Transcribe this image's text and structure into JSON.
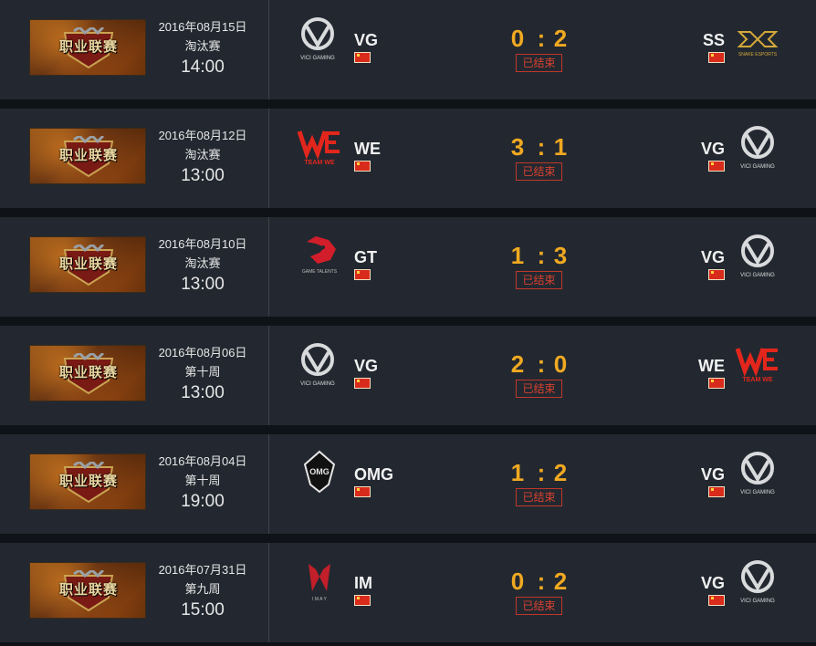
{
  "banner_text": "职业联赛",
  "matches": [
    {
      "date": "2016年08月15日",
      "stage": "淘汰赛",
      "time": "14:00",
      "team1": {
        "name": "VG",
        "logo": "vici-gaming-logo",
        "logo_text": "VICI GAMING"
      },
      "team2": {
        "name": "SS",
        "logo": "ss-logo",
        "logo_text": "SNAKE ESPORTS"
      },
      "score1": "0",
      "score2": "2",
      "status": "已结束"
    },
    {
      "date": "2016年08月12日",
      "stage": "淘汰赛",
      "time": "13:00",
      "team1": {
        "name": "WE",
        "logo": "team-we-logo",
        "logo_text": "TEAM WE"
      },
      "team2": {
        "name": "VG",
        "logo": "vici-gaming-logo",
        "logo_text": "VICI GAMING"
      },
      "score1": "3",
      "score2": "1",
      "status": "已结束"
    },
    {
      "date": "2016年08月10日",
      "stage": "淘汰赛",
      "time": "13:00",
      "team1": {
        "name": "GT",
        "logo": "gt-logo",
        "logo_text": "GAME TALENTS"
      },
      "team2": {
        "name": "VG",
        "logo": "vici-gaming-logo",
        "logo_text": "VICI GAMING"
      },
      "score1": "1",
      "score2": "3",
      "status": "已结束"
    },
    {
      "date": "2016年08月06日",
      "stage": "第十周",
      "time": "13:00",
      "team1": {
        "name": "VG",
        "logo": "vici-gaming-logo",
        "logo_text": "VICI GAMING"
      },
      "team2": {
        "name": "WE",
        "logo": "team-we-logo",
        "logo_text": "TEAM WE"
      },
      "score1": "2",
      "score2": "0",
      "status": "已结束"
    },
    {
      "date": "2016年08月04日",
      "stage": "第十周",
      "time": "19:00",
      "team1": {
        "name": "OMG",
        "logo": "omg-logo",
        "logo_text": "OMG"
      },
      "team2": {
        "name": "VG",
        "logo": "vici-gaming-logo",
        "logo_text": "VICI GAMING"
      },
      "score1": "1",
      "score2": "2",
      "status": "已结束"
    },
    {
      "date": "2016年07月31日",
      "stage": "第九周",
      "time": "15:00",
      "team1": {
        "name": "IM",
        "logo": "im-logo",
        "logo_text": "I M A Y"
      },
      "team2": {
        "name": "VG",
        "logo": "vici-gaming-logo",
        "logo_text": "VICI GAMING"
      },
      "score1": "0",
      "score2": "2",
      "status": "已结束"
    }
  ],
  "colors": {
    "row_bg": "#232830",
    "score": "#f0a921",
    "status": "#d8412f",
    "flag": "#d92b1c"
  }
}
